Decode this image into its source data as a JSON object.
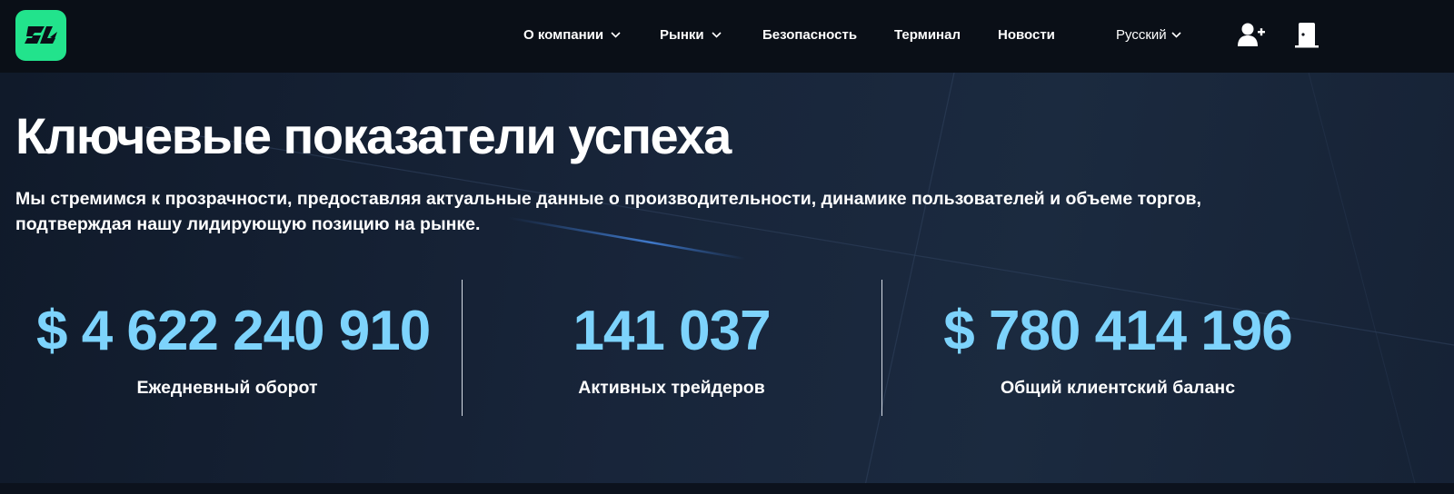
{
  "header": {
    "logo_text": "BL",
    "nav": [
      {
        "label": "О компании",
        "dropdown": true
      },
      {
        "label": "Рынки",
        "dropdown": true
      },
      {
        "label": "Безопасность",
        "dropdown": false
      },
      {
        "label": "Терминал",
        "dropdown": false
      },
      {
        "label": "Новости",
        "dropdown": false
      }
    ],
    "language": "Русский",
    "icons": [
      "add-user-icon",
      "door-icon"
    ]
  },
  "hero": {
    "title": "Ключевые показатели успеха",
    "subtitle": "Мы стремимся к прозрачности, предоставляя актуальные данные о производительности, динамике пользователей и объеме торгов, подтверждая нашу лидирующую позицию на рынке.",
    "stats": [
      {
        "value": "$ 4 622 240 910",
        "label": "Ежедневный оборот"
      },
      {
        "value": "141 037",
        "label": "Активных трейдеров"
      },
      {
        "value": "$ 780 414 196",
        "label": "Общий клиентский баланс"
      }
    ]
  },
  "colors": {
    "accent_green": "#22e38c",
    "stat_blue": "#7dd3fc",
    "header_bg": "#0a0f17",
    "hero_bg": "#18253a"
  }
}
